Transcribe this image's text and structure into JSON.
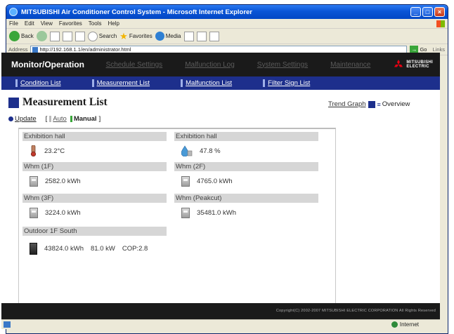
{
  "browser": {
    "title": "MITSUBISHI Air Conditioner Control System - Microsoft Internet Explorer",
    "menu": [
      "File",
      "Edit",
      "View",
      "Favorites",
      "Tools",
      "Help"
    ],
    "toolbar": {
      "back": "Back",
      "search": "Search",
      "favorites": "Favorites",
      "media": "Media"
    },
    "address_label": "Address",
    "address": "http://192.168.1.1/en/administrator.html",
    "go": "Go",
    "links": "Links",
    "status_zone": "Internet"
  },
  "nav": {
    "brand": "Monitor/Operation",
    "items": [
      "Schedule Settings",
      "Malfunction Log",
      "System Settings",
      "Maintenance"
    ],
    "logo_text": [
      "MITSUBISHI",
      "ELECTRIC"
    ]
  },
  "subnav": {
    "items": [
      "Condition List",
      "Measurement List",
      "Malfunction List",
      "Filter Sign List"
    ]
  },
  "page": {
    "title": "Measurement List",
    "trend_link": "Trend Graph",
    "overview": "Overview",
    "update": "Update",
    "bracket_open": "[",
    "bracket_close": "]",
    "auto": "Auto",
    "manual": "Manual"
  },
  "measurements": [
    {
      "name": "Exhibition hall",
      "value": "23.2°C",
      "icon": "thermometer-icon"
    },
    {
      "name": "Exhibition hall",
      "value": "47.8 %",
      "icon": "humidity-drop-icon"
    },
    {
      "name": "Whm (1F)",
      "value": "2582.0 kWh",
      "icon": "meter-icon"
    },
    {
      "name": "Whm (2F)",
      "value": "4765.0 kWh",
      "icon": "meter-icon"
    },
    {
      "name": "Whm (3F)",
      "value": "3224.0 kWh",
      "icon": "meter-icon"
    },
    {
      "name": "Whm (Peakcut)",
      "value": "35481.0 kWh",
      "icon": "meter-icon"
    },
    {
      "name": "Outdoor 1F South",
      "value": "43824.0 kWh",
      "power": "81.0 kW",
      "cop": "COP:2.8",
      "icon": "outdoor-unit-icon"
    }
  ],
  "footer": {
    "copyright": "Copyright(C) 2002-2007 MITSUBISHI ELECTRIC CORPORATION All Rights Reserved"
  },
  "colors": {
    "nav_bg": "#1a1a1a",
    "subnav_bg": "#1D2F8C",
    "accent_red": "#E60012",
    "manual_green": "#3aa63a"
  }
}
